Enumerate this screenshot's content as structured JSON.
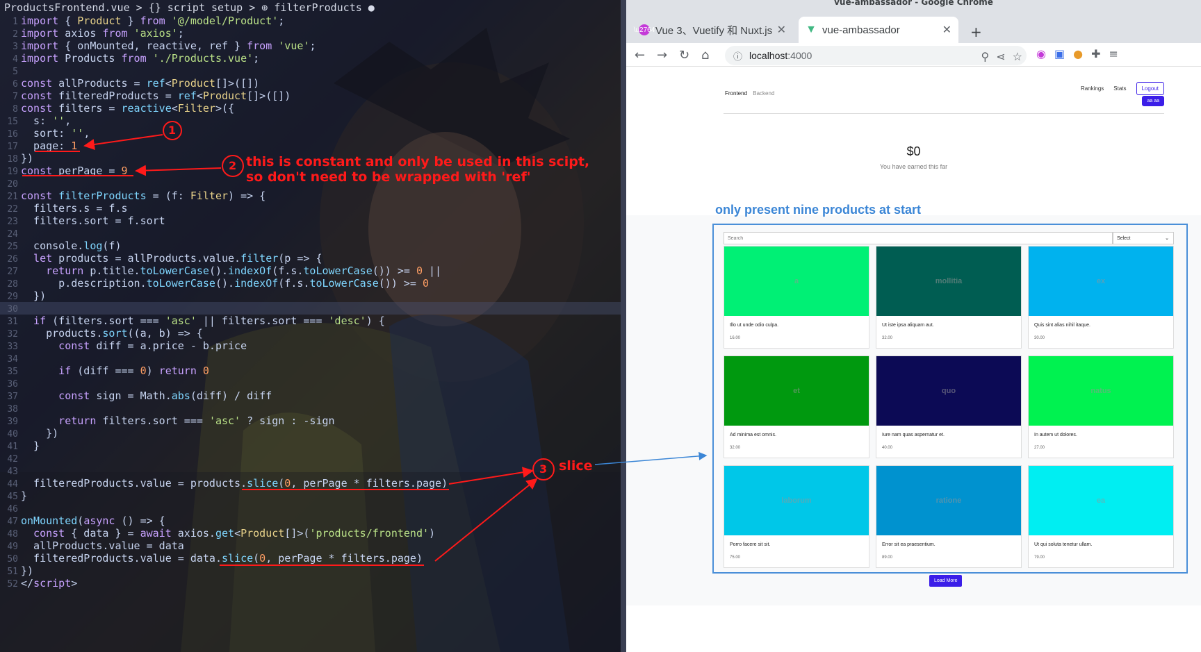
{
  "editor": {
    "breadcrumb": "ProductsFrontend.vue > {} script setup > ⊕ filterProducts ●",
    "lines": [
      {
        "n": "1",
        "segs": [
          [
            "kw",
            "import"
          ],
          [
            "tx",
            " { "
          ],
          [
            "ty",
            "Product"
          ],
          [
            "tx",
            " } "
          ],
          [
            "kw",
            "from"
          ],
          [
            "str",
            " '@/model/Product'"
          ],
          [
            "tx",
            ";"
          ]
        ]
      },
      {
        "n": "2",
        "segs": [
          [
            "kw",
            "import"
          ],
          [
            "tx",
            " axios "
          ],
          [
            "kw",
            "from"
          ],
          [
            "str",
            " 'axios'"
          ],
          [
            "tx",
            ";"
          ]
        ]
      },
      {
        "n": "3",
        "segs": [
          [
            "kw",
            "import"
          ],
          [
            "tx",
            " { onMounted, reactive, ref } "
          ],
          [
            "kw",
            "from"
          ],
          [
            "str",
            " 'vue'"
          ],
          [
            "tx",
            ";"
          ]
        ]
      },
      {
        "n": "4",
        "segs": [
          [
            "kw",
            "import"
          ],
          [
            "tx",
            " Products "
          ],
          [
            "kw",
            "from"
          ],
          [
            "str",
            " './Products.vue'"
          ],
          [
            "tx",
            ";"
          ]
        ]
      },
      {
        "n": "5",
        "segs": []
      },
      {
        "n": "6",
        "segs": [
          [
            "kw",
            "const"
          ],
          [
            "tx",
            " allProducts = "
          ],
          [
            "fn",
            "ref"
          ],
          [
            "tx",
            "<"
          ],
          [
            "ty",
            "Product"
          ],
          [
            "tx",
            "[]>([])"
          ]
        ]
      },
      {
        "n": "7",
        "segs": [
          [
            "kw",
            "const"
          ],
          [
            "tx",
            " filteredProducts = "
          ],
          [
            "fn",
            "ref"
          ],
          [
            "tx",
            "<"
          ],
          [
            "ty",
            "Product"
          ],
          [
            "tx",
            "[]>([])"
          ]
        ]
      },
      {
        "n": "8",
        "segs": [
          [
            "kw",
            "const"
          ],
          [
            "tx",
            " filters = "
          ],
          [
            "fn",
            "reactive"
          ],
          [
            "tx",
            "<"
          ],
          [
            "ty",
            "Filter"
          ],
          [
            "tx",
            ">({"
          ]
        ]
      },
      {
        "n": "15",
        "segs": [
          [
            "tx",
            "  s: "
          ],
          [
            "str",
            "''"
          ],
          [
            "tx",
            ","
          ]
        ]
      },
      {
        "n": "16",
        "segs": [
          [
            "tx",
            "  sort: "
          ],
          [
            "str",
            "''"
          ],
          [
            "tx",
            ","
          ]
        ]
      },
      {
        "n": "17",
        "segs": [
          [
            "tx",
            "  page: "
          ],
          [
            "num",
            "1"
          ]
        ]
      },
      {
        "n": "18",
        "segs": [
          [
            "tx",
            "})"
          ]
        ]
      },
      {
        "n": "19",
        "segs": [
          [
            "kw",
            "const"
          ],
          [
            "tx",
            " perPage = "
          ],
          [
            "num",
            "9"
          ]
        ]
      },
      {
        "n": "20",
        "segs": []
      },
      {
        "n": "21",
        "segs": [
          [
            "kw",
            "const"
          ],
          [
            "fn",
            " filterProducts"
          ],
          [
            "tx",
            " = (f: "
          ],
          [
            "ty",
            "Filter"
          ],
          [
            "tx",
            ") => {"
          ]
        ]
      },
      {
        "n": "22",
        "segs": [
          [
            "tx",
            "  filters.s = f.s"
          ]
        ]
      },
      {
        "n": "23",
        "segs": [
          [
            "tx",
            "  filters.sort = f.sort"
          ]
        ]
      },
      {
        "n": "24",
        "segs": []
      },
      {
        "n": "25",
        "segs": [
          [
            "tx",
            "  console."
          ],
          [
            "fn",
            "log"
          ],
          [
            "tx",
            "(f)"
          ]
        ]
      },
      {
        "n": "26",
        "segs": [
          [
            "kw",
            "  let"
          ],
          [
            "tx",
            " products = allProducts.value."
          ],
          [
            "fn",
            "filter"
          ],
          [
            "tx",
            "(p => {"
          ]
        ]
      },
      {
        "n": "27",
        "segs": [
          [
            "kw",
            "    return"
          ],
          [
            "tx",
            " p.title."
          ],
          [
            "fn",
            "toLowerCase"
          ],
          [
            "tx",
            "()."
          ],
          [
            "fn",
            "indexOf"
          ],
          [
            "tx",
            "(f.s."
          ],
          [
            "fn",
            "toLowerCase"
          ],
          [
            "tx",
            "()) >= "
          ],
          [
            "num",
            "0"
          ],
          [
            "tx",
            " ||"
          ]
        ]
      },
      {
        "n": "28",
        "segs": [
          [
            "tx",
            "      p.description."
          ],
          [
            "fn",
            "toLowerCase"
          ],
          [
            "tx",
            "()."
          ],
          [
            "fn",
            "indexOf"
          ],
          [
            "tx",
            "(f.s."
          ],
          [
            "fn",
            "toLowerCase"
          ],
          [
            "tx",
            "()) >= "
          ],
          [
            "num",
            "0"
          ]
        ]
      },
      {
        "n": "29",
        "segs": [
          [
            "tx",
            "  })"
          ]
        ]
      },
      {
        "n": "30",
        "segs": [],
        "active": true
      },
      {
        "n": "31",
        "segs": [
          [
            "kw",
            "  if"
          ],
          [
            "tx",
            " (filters.sort === "
          ],
          [
            "str",
            "'asc'"
          ],
          [
            "tx",
            " || filters.sort === "
          ],
          [
            "str",
            "'desc'"
          ],
          [
            "tx",
            ") {"
          ]
        ]
      },
      {
        "n": "32",
        "segs": [
          [
            "tx",
            "    products."
          ],
          [
            "fn",
            "sort"
          ],
          [
            "tx",
            "((a, b) => {"
          ]
        ]
      },
      {
        "n": "33",
        "segs": [
          [
            "kw",
            "      const"
          ],
          [
            "tx",
            " diff = a.price - b.price"
          ]
        ]
      },
      {
        "n": "34",
        "segs": []
      },
      {
        "n": "35",
        "segs": [
          [
            "kw",
            "      if"
          ],
          [
            "tx",
            " (diff === "
          ],
          [
            "num",
            "0"
          ],
          [
            "tx",
            ") "
          ],
          [
            "kw",
            "return"
          ],
          [
            "num",
            " 0"
          ]
        ]
      },
      {
        "n": "36",
        "segs": []
      },
      {
        "n": "37",
        "segs": [
          [
            "kw",
            "      const"
          ],
          [
            "tx",
            " sign = Math."
          ],
          [
            "fn",
            "abs"
          ],
          [
            "tx",
            "(diff) / diff"
          ]
        ]
      },
      {
        "n": "38",
        "segs": []
      },
      {
        "n": "39",
        "segs": [
          [
            "kw",
            "      return"
          ],
          [
            "tx",
            " filters.sort === "
          ],
          [
            "str",
            "'asc'"
          ],
          [
            "tx",
            " ? sign : -sign"
          ]
        ]
      },
      {
        "n": "40",
        "segs": [
          [
            "tx",
            "    })"
          ]
        ]
      },
      {
        "n": "41",
        "segs": [
          [
            "tx",
            "  }"
          ]
        ]
      },
      {
        "n": "42",
        "segs": []
      },
      {
        "n": "43",
        "segs": []
      },
      {
        "n": "44",
        "segs": [
          [
            "tx",
            "  filteredProducts.value = products."
          ],
          [
            "fn",
            "slice"
          ],
          [
            "tx",
            "("
          ],
          [
            "num",
            "0"
          ],
          [
            "tx",
            ", perPage * filters.page)"
          ]
        ]
      },
      {
        "n": "45",
        "segs": [
          [
            "tx",
            "}"
          ]
        ]
      },
      {
        "n": "46",
        "segs": []
      },
      {
        "n": "47",
        "segs": [
          [
            "fn",
            "onMounted"
          ],
          [
            "tx",
            "("
          ],
          [
            "kw",
            "async"
          ],
          [
            "tx",
            " () => {"
          ]
        ]
      },
      {
        "n": "48",
        "segs": [
          [
            "kw",
            "  const"
          ],
          [
            "tx",
            " { data } = "
          ],
          [
            "kw",
            "await"
          ],
          [
            "tx",
            " axios."
          ],
          [
            "fn",
            "get"
          ],
          [
            "tx",
            "<"
          ],
          [
            "ty",
            "Product"
          ],
          [
            "tx",
            "[]>("
          ],
          [
            "str",
            "'products/frontend'"
          ],
          [
            "tx",
            ")"
          ]
        ]
      },
      {
        "n": "49",
        "segs": [
          [
            "tx",
            "  allProducts.value = data"
          ]
        ]
      },
      {
        "n": "50",
        "segs": [
          [
            "tx",
            "  filteredProducts.value = data."
          ],
          [
            "fn",
            "slice"
          ],
          [
            "tx",
            "("
          ],
          [
            "num",
            "0"
          ],
          [
            "tx",
            ", perPage * filters.page)"
          ]
        ]
      },
      {
        "n": "51",
        "segs": [
          [
            "tx",
            "})"
          ]
        ]
      },
      {
        "n": "52",
        "segs": [
          [
            "tx",
            "</"
          ],
          [
            "kw",
            "script"
          ],
          [
            "tx",
            ">"
          ]
        ]
      }
    ]
  },
  "annotations": {
    "c1": "1",
    "c2": "2",
    "c3": "3",
    "note2": "this is constant and only be used in this scipt,\nso don't need to be wrapped with 'ref'",
    "note3": "slice",
    "heading": "only present nine products at start",
    "color_red": "#ff1a1a",
    "color_blue": "#3b86d6"
  },
  "browser": {
    "window_title": "vue-ambassador - Google Chrome",
    "tabs": [
      {
        "label": "Vue 3、Vuetify 和 Nuxt.js",
        "icon": "vuetify-favicon"
      },
      {
        "label": "vue-ambassador",
        "icon": "vue-favicon"
      }
    ],
    "url_host": "localhost",
    "url_port": ":4000",
    "site": {
      "nav_frontend": "Frontend",
      "nav_backend": "Backend",
      "rankings": "Rankings",
      "stats": "Stats",
      "logout": "Logout",
      "user": "aa aa",
      "earnings_amount": "$0",
      "earnings_sub": "You have earned this far",
      "search_placeholder": "Search",
      "sort_value": "Select",
      "load_more": "Load More",
      "products": [
        {
          "word": "a",
          "title": "Illo ut unde odio culpa.",
          "price": "16.00",
          "color": "#00f075"
        },
        {
          "word": "mollitia",
          "title": "Ut iste ipsa aliquam aut.",
          "price": "32.00",
          "color": "#005d52"
        },
        {
          "word": "ex",
          "title": "Quis sint alias nihil itaque.",
          "price": "30.00",
          "color": "#00b2ee"
        },
        {
          "word": "et",
          "title": "Ad minima est omnis.",
          "price": "32.00",
          "color": "#00990f"
        },
        {
          "word": "quo",
          "title": "Iure nam quas aspernatur et.",
          "price": "40.00",
          "color": "#0c0a55"
        },
        {
          "word": "natus",
          "title": "In autem ut dolores.",
          "price": "27.00",
          "color": "#00f250"
        },
        {
          "word": "laborum",
          "title": "Porro facere sit sit.",
          "price": "75.00",
          "color": "#00c7e8"
        },
        {
          "word": "ratione",
          "title": "Error sit ea praesentium.",
          "price": "89.00",
          "color": "#0092cf"
        },
        {
          "word": "ea",
          "title": "Ut qui soluta tenetur ullam.",
          "price": "79.00",
          "color": "#00eef2"
        }
      ]
    }
  }
}
